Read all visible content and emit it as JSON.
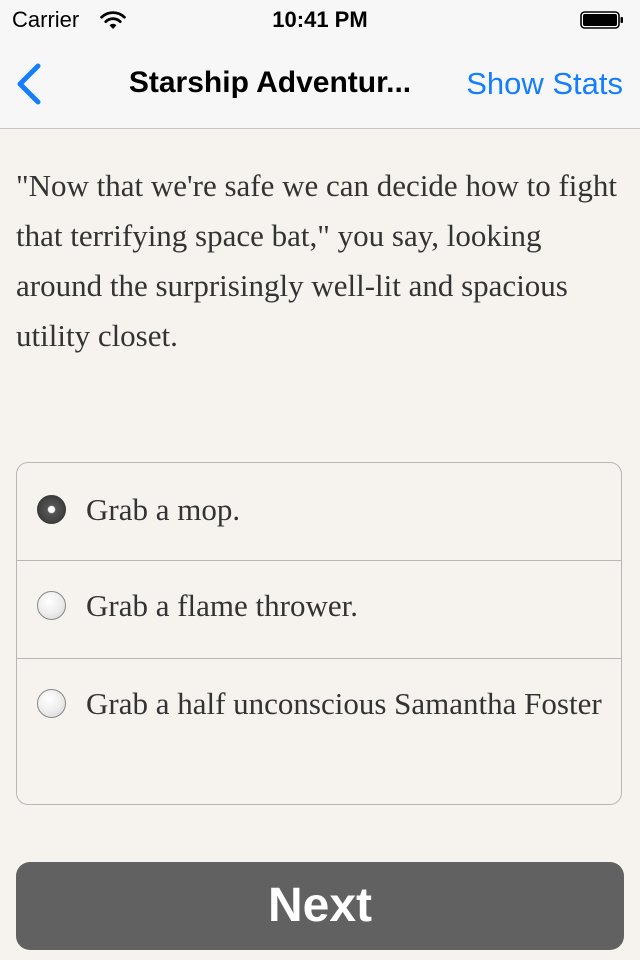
{
  "status_bar": {
    "carrier": "Carrier",
    "time": "10:41 PM",
    "wifi_icon": "wifi-icon",
    "battery_icon": "battery-icon"
  },
  "nav_bar": {
    "back_icon": "chevron-left-icon",
    "title": "Starship Adventur...",
    "stats_button": "Show Stats",
    "accent_color": "#147efb"
  },
  "story": {
    "text": "\"Now that we're safe we can decide how to fight that terrifying space bat,\" you say, looking around the surprisingly well-lit and spacious utility closet."
  },
  "choices": {
    "options": [
      {
        "label": "Grab a mop.",
        "selected": true
      },
      {
        "label": "Grab a flame thrower.",
        "selected": false
      },
      {
        "label": "Grab a half unconscious Samantha Foster",
        "selected": false
      }
    ]
  },
  "footer": {
    "next_button": "Next",
    "button_color": "#616161"
  }
}
